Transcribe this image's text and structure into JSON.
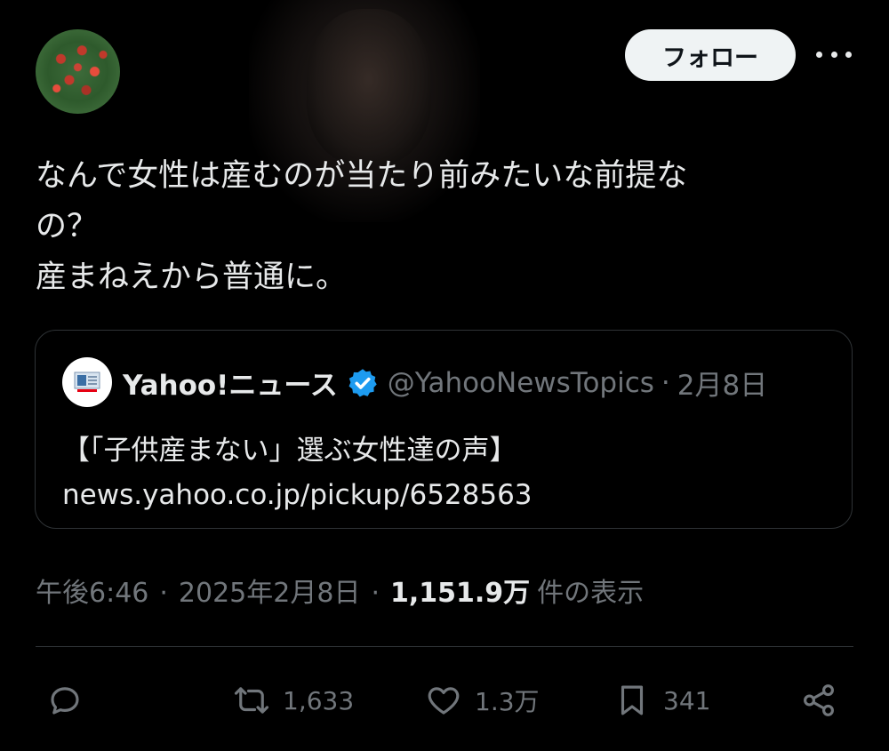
{
  "tweet": {
    "follow_label": "フォロー",
    "text_lines": [
      "なんで女性は産むのが当たり前みたいな前提な",
      "の？",
      "産まねえから普通に。"
    ],
    "quote": {
      "name": "Yahoo!ニュース",
      "handle": "@YahooNewsTopics",
      "separator": "·",
      "date": "2月8日",
      "body_lines": [
        "【「子供産まない」選ぶ女性達の声】",
        "news.yahoo.co.jp/pickup/6528563"
      ],
      "avatar_logo_text": "YAHOO!"
    },
    "meta": {
      "time": "午後6:46",
      "date": "2025年2月8日",
      "separator": "·",
      "views_count": "1,151.9万",
      "views_suffix": "件の表示"
    },
    "actions": {
      "replies": "",
      "retweets": "1,633",
      "likes": "1.3万",
      "bookmarks": "341"
    }
  },
  "icons": {
    "more": "more-horizontal-icon",
    "verified": "verified-badge-icon",
    "reply": "reply-icon",
    "retweet": "retweet-icon",
    "like": "heart-icon",
    "bookmark": "bookmark-icon",
    "share": "share-icon"
  },
  "colors": {
    "background": "#000000",
    "text": "#e7e9ea",
    "secondary": "#71767b",
    "verified": "#1d9bf0",
    "border": "#2f3336"
  }
}
